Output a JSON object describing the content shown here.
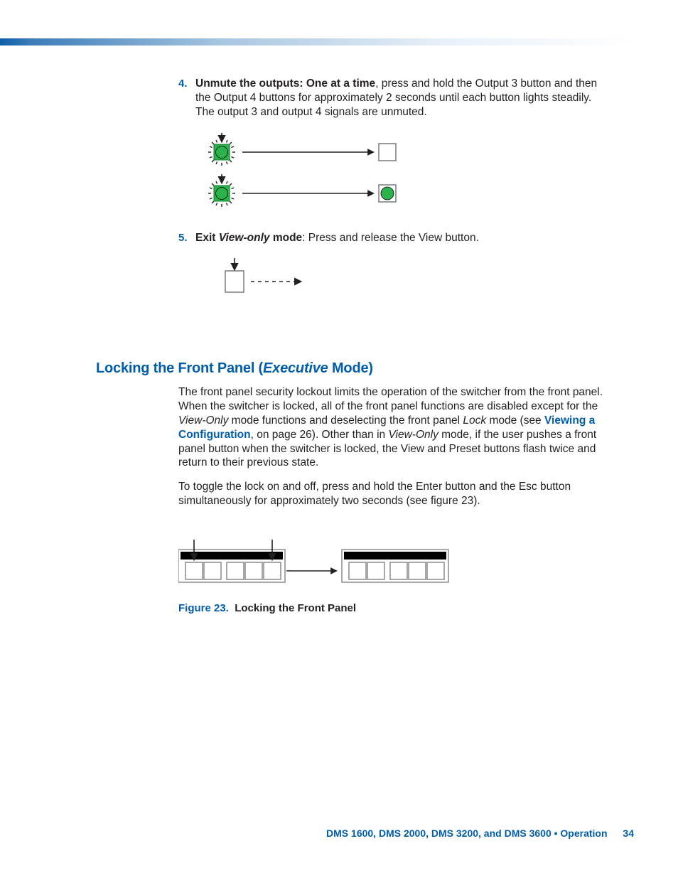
{
  "steps": [
    {
      "num": "4.",
      "lead_bold": "Unmute the outputs",
      "lead_rest": ": One at a time",
      "rest": ", press and hold the Output 3 button and then the Output 4 buttons for approximately 2 seconds until each button lights steadily. The output 3 and output 4 signals are unmuted."
    },
    {
      "num": "5.",
      "lead_bold": "Exit ",
      "lead_bi": "View-only",
      "lead_bold2": " mode",
      "rest": ": Press and release the View button."
    }
  ],
  "section": {
    "title_pre": "Locking the Front Panel (",
    "title_em": "Executive",
    "title_post": " Mode)"
  },
  "para1": {
    "a": "The front panel security lockout limits the operation of the switcher from the front panel. When the switcher is locked, all of the front panel functions are disabled except for the ",
    "i1": "View-Only",
    "b": " mode functions and deselecting the front panel ",
    "i2": "Lock",
    "c": " mode (see ",
    "link": "Viewing a Configuration",
    "d": ", on page 26). Other than in ",
    "i3": "View-Only",
    "e": " mode, if the user pushes a front panel button when the switcher is locked, the View and Preset buttons flash twice and return to their previous state."
  },
  "para2": "To toggle the lock on and off, press and hold the Enter button and the Esc button simultaneously for approximately two seconds (see figure 23).",
  "figure": {
    "num": "Figure 23.",
    "title": "Locking the Front Panel"
  },
  "footer": {
    "text": "DMS 1600, DMS 2000, DMS 3200, and DMS 3600 • Operation",
    "page": "34"
  }
}
